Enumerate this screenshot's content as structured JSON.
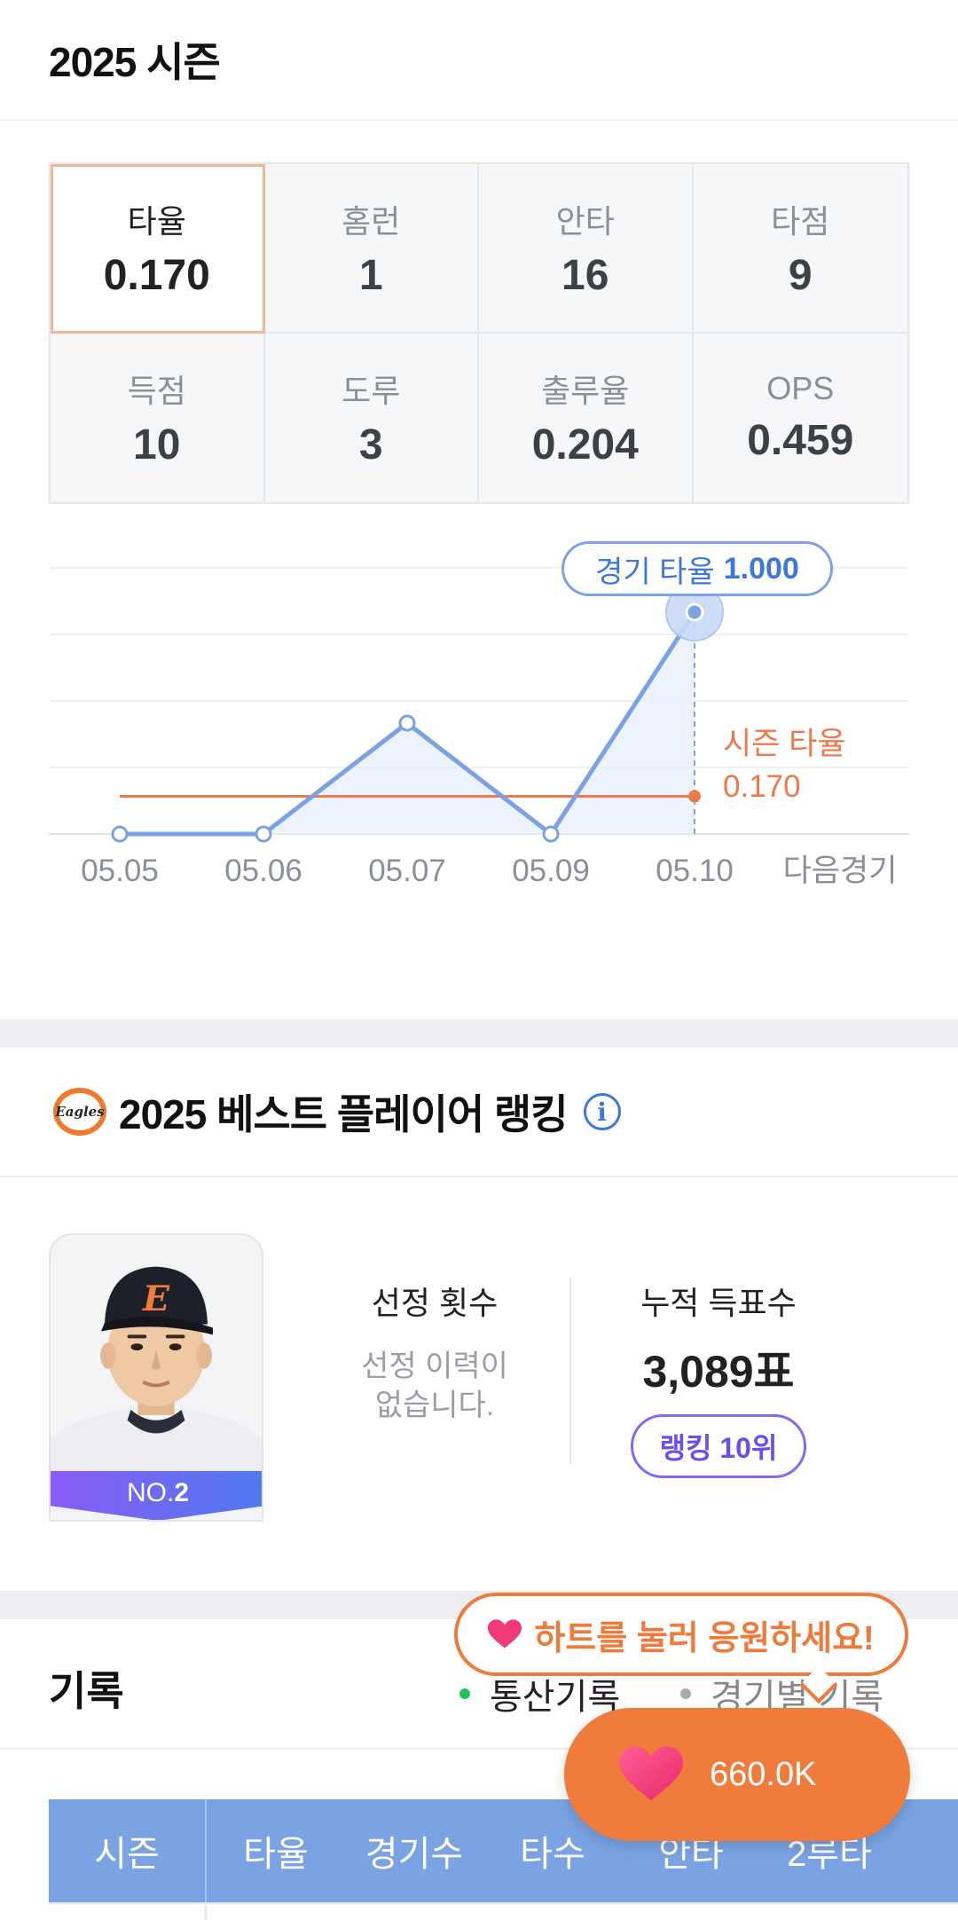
{
  "season": {
    "title": "2025 시즌"
  },
  "stats": [
    {
      "label": "타율",
      "value": "0.170",
      "active": true
    },
    {
      "label": "홈런",
      "value": "1"
    },
    {
      "label": "안타",
      "value": "16"
    },
    {
      "label": "타점",
      "value": "9"
    },
    {
      "label": "득점",
      "value": "10"
    },
    {
      "label": "도루",
      "value": "3"
    },
    {
      "label": "출루율",
      "value": "0.204"
    },
    {
      "label": "OPS",
      "value": "0.459"
    }
  ],
  "chart_data": {
    "type": "line",
    "categories": [
      "05.05",
      "05.06",
      "05.07",
      "05.09",
      "05.10",
      "다음경기"
    ],
    "series": [
      {
        "name": "경기 타율",
        "values": [
          0.0,
          0.0,
          0.5,
          0.0,
          1.0
        ]
      }
    ],
    "season_avg": 0.17,
    "ylim": [
      0,
      1.2
    ],
    "grid": true,
    "callout": {
      "prefix": "경기 타율",
      "value": "1.000"
    },
    "season_label": {
      "line1": "시즌 타율",
      "line2": "0.170"
    },
    "colors": {
      "line": "#7ba3e3",
      "avg": "#ee7a4c"
    }
  },
  "ranking": {
    "team_logo_text": "Eagles",
    "title": "2025 베스트 플레이어 랭킹",
    "player_number_prefix": "NO.",
    "player_number": "2",
    "selection_label": "선정 횟수",
    "selection_desc_line1": "선정 이력이",
    "selection_desc_line2": "없습니다.",
    "votes_label": "누적 득표수",
    "votes_value": "3,089표",
    "rank_pill": "랭킹 10위"
  },
  "records": {
    "title": "기록",
    "tab_total": "통산기록",
    "tab_game": "경기별 기록",
    "columns": [
      "시즌",
      "타율",
      "경기수",
      "타수",
      "안타",
      "2루타"
    ]
  },
  "cheer": {
    "tooltip": "하트를 눌러 응원하세요!",
    "count": "660.0K"
  }
}
